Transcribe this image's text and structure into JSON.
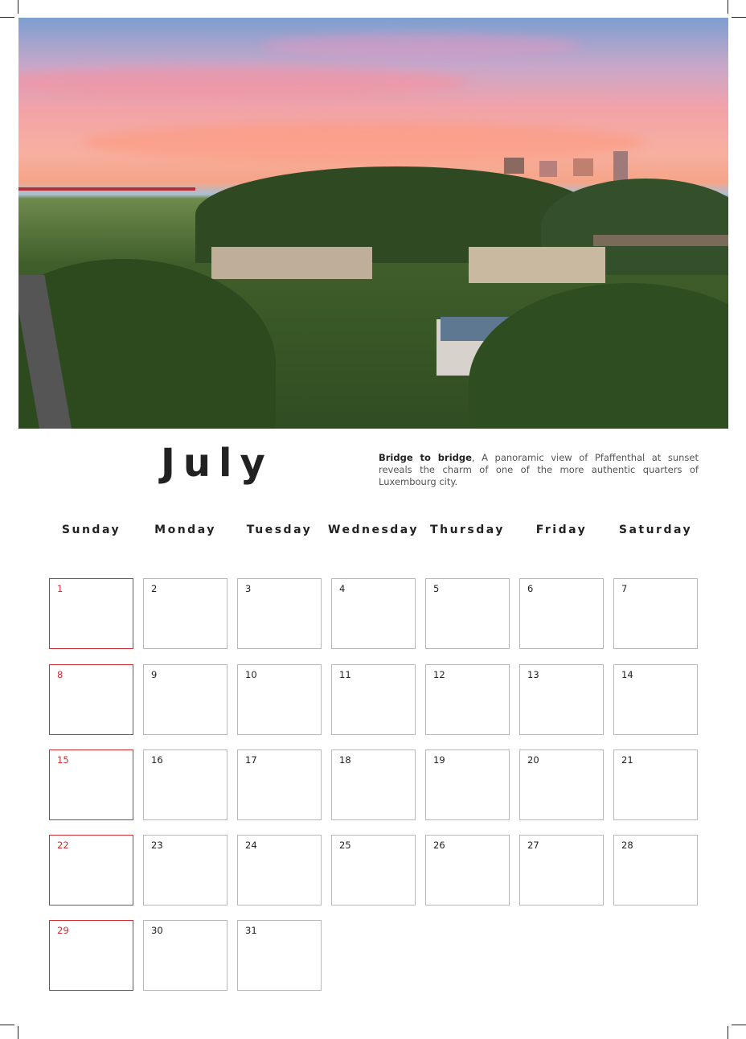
{
  "month": "July",
  "caption": {
    "bold": "Bridge to bridge",
    "text": ", A panoramic view of Pfaffenthal at sunset reveals the charm of one of the more authentic quarters of Luxembourg city."
  },
  "weekdays": [
    "Sunday",
    "Monday",
    "Tuesday",
    "Wednesday",
    "Thursday",
    "Friday",
    "Saturday"
  ],
  "days": [
    [
      "1",
      "2",
      "3",
      "4",
      "5",
      "6",
      "7"
    ],
    [
      "8",
      "9",
      "10",
      "11",
      "12",
      "13",
      "14"
    ],
    [
      "15",
      "16",
      "17",
      "18",
      "19",
      "20",
      "21"
    ],
    [
      "22",
      "23",
      "24",
      "25",
      "26",
      "27",
      "28"
    ],
    [
      "29",
      "30",
      "31"
    ]
  ],
  "colors": {
    "sunday_accent": "#d42a32",
    "cell_border": "#b8b8b8",
    "text": "#222222"
  }
}
